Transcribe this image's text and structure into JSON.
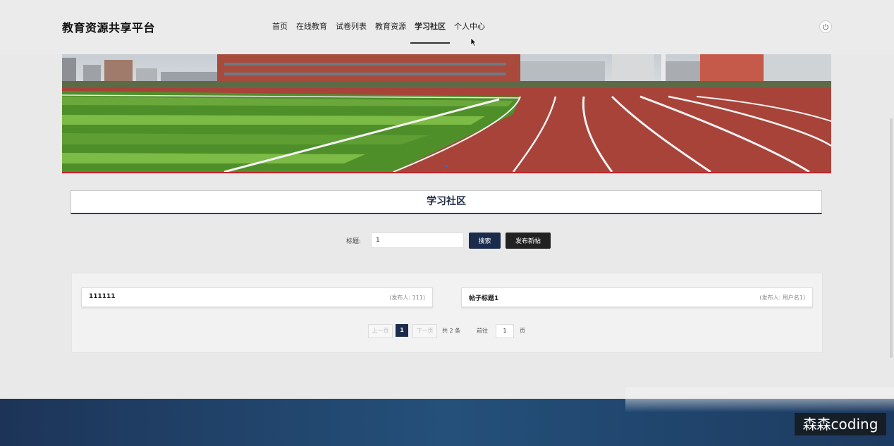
{
  "header": {
    "site_title": "教育资源共享平台",
    "nav": [
      "首页",
      "在线教育",
      "试卷列表",
      "教育资源",
      "学习社区",
      "个人中心"
    ],
    "active_nav": "学习社区",
    "power_icon": "power-icon"
  },
  "section": {
    "title": "学习社区"
  },
  "search": {
    "label": "标题:",
    "value": "1",
    "search_button": "搜索",
    "publish_button": "发布新帖"
  },
  "posts": [
    {
      "title": "111111",
      "author": "(发布人: 111)"
    },
    {
      "title": "帖子标题1",
      "author": "(发布人: 用户名1)"
    }
  ],
  "pagination": {
    "prev": "上一页",
    "current": "1",
    "next": "下一页",
    "total": "共 2 条",
    "goto_label": "前往",
    "goto_value": "1",
    "page_unit": "页"
  },
  "watermark": "森森coding",
  "colors": {
    "primary": "#1a2b4c",
    "publish": "#222222",
    "track": "#a8433a",
    "grass": "#4f8f2a"
  }
}
